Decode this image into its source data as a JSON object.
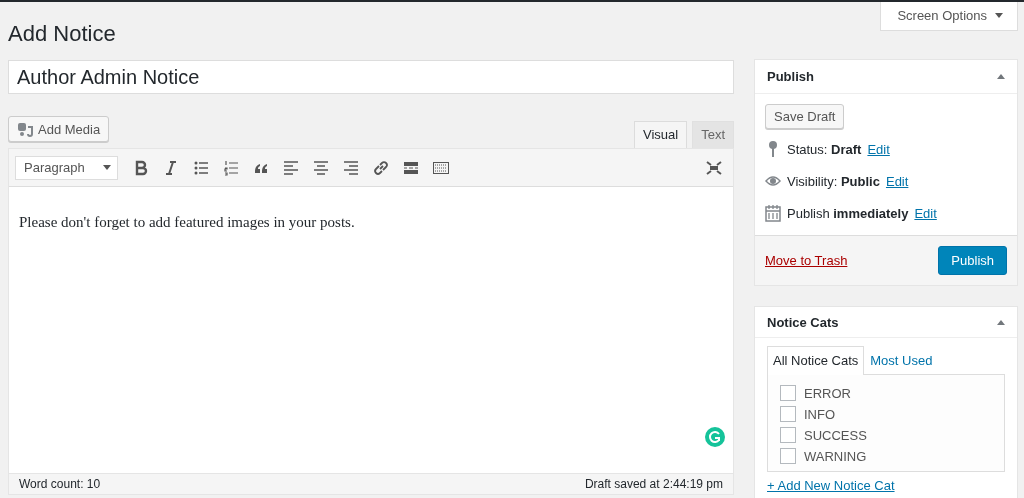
{
  "page_title": "Add Notice",
  "screen_options": {
    "label": "Screen Options"
  },
  "title_field": {
    "value": "Author Admin Notice"
  },
  "add_media": {
    "label": "Add Media"
  },
  "editor_tabs": [
    {
      "label": "Visual",
      "selected": true
    },
    {
      "label": "Text",
      "selected": false
    }
  ],
  "format_select": {
    "value": "Paragraph"
  },
  "content": "Please don't forget to add featured images in your posts.",
  "status_bar": {
    "word_count": "Word count: 10",
    "saved": "Draft saved at 2:44:19 pm"
  },
  "publish_box": {
    "title": "Publish",
    "expanded": true,
    "save_draft": "Save Draft",
    "rows": [
      {
        "kind": "status",
        "text": "Status: **Draft**",
        "link": "Edit"
      },
      {
        "kind": "visibility",
        "text": "Visibility: **Public**",
        "link": "Edit"
      },
      {
        "kind": "schedule",
        "text": "Publish **immediately**",
        "link": "Edit"
      }
    ],
    "trash": "Move to Trash",
    "publish": "Publish"
  },
  "cats_box": {
    "title": "Notice Cats",
    "expanded": true,
    "tabs": [
      {
        "label": "All Notice Cats",
        "selected": true
      },
      {
        "label": "Most Used",
        "selected": false
      }
    ],
    "items": [
      {
        "label": "ERROR",
        "checked": false
      },
      {
        "label": "INFO",
        "checked": false
      },
      {
        "label": "SUCCESS",
        "checked": false
      },
      {
        "label": "WARNING",
        "checked": false
      }
    ],
    "add_link": "+ Add New Notice Cat"
  }
}
